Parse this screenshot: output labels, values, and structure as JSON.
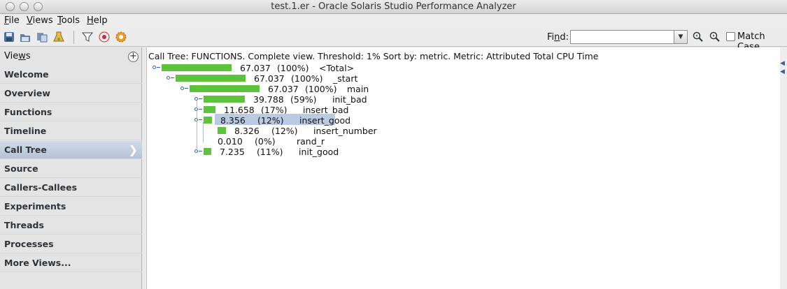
{
  "window": {
    "title": "test.1.er  -  Oracle Solaris Studio Performance Analyzer"
  },
  "menu": [
    {
      "pre": "",
      "key": "F",
      "post": "ile"
    },
    {
      "pre": "",
      "key": "V",
      "post": "iews"
    },
    {
      "pre": "",
      "key": "T",
      "post": "ools"
    },
    {
      "pre": "",
      "key": "H",
      "post": "elp"
    }
  ],
  "toolbar": {
    "find_pre": "Fi",
    "find_key": "n",
    "find_post": "d:",
    "find_value": "",
    "match_case_label": "Match Case",
    "match_case_checked": false
  },
  "sidebar": {
    "header_pre": "Vie",
    "header_key": "w",
    "header_post": "s",
    "add_symbol": "+",
    "items": [
      {
        "label": "Welcome",
        "active": false
      },
      {
        "label": "Overview",
        "active": false
      },
      {
        "label": "Functions",
        "active": false
      },
      {
        "label": "Timeline",
        "active": false
      },
      {
        "label": "Call Tree",
        "active": true
      },
      {
        "label": "Source",
        "active": false
      },
      {
        "label": "Callers-Callees",
        "active": false
      },
      {
        "label": "Experiments",
        "active": false
      },
      {
        "label": "Threads",
        "active": false
      },
      {
        "label": "Processes",
        "active": false
      },
      {
        "label": "More Views...",
        "active": false
      }
    ]
  },
  "calltree": {
    "header": "Call Tree: FUNCTIONS.   Complete view.   Threshold: 1%   Sort by: metric.   Metric: Attributed Total CPU Time",
    "rows": [
      {
        "value": "67.037",
        "percent": "(100%)",
        "name": "<Total>",
        "fraction": 1.0,
        "highlight": false
      },
      {
        "value": "67.037",
        "percent": "(100%)",
        "name": "_start",
        "fraction": 1.0,
        "highlight": false
      },
      {
        "value": "67.037",
        "percent": "(100%)",
        "name": "main",
        "fraction": 1.0,
        "highlight": false
      },
      {
        "value": "39.788",
        "percent": "(59%)",
        "name": "init_bad",
        "fraction": 0.59,
        "highlight": false
      },
      {
        "value": "11.658",
        "percent": "(17%)",
        "name": "insert_bad",
        "fraction": 0.17,
        "highlight": false
      },
      {
        "value": "8.356",
        "percent": "(12%)",
        "name": "insert_good",
        "fraction": 0.12,
        "highlight": true
      },
      {
        "value": "8.326",
        "percent": "(12%)",
        "name": "insert_number",
        "fraction": 0.12,
        "highlight": false
      },
      {
        "value": "0.010",
        "percent": "(0%)",
        "name": "rand_r",
        "fraction": 0.0,
        "highlight": false
      },
      {
        "value": "7.235",
        "percent": "(11%)",
        "name": "init_good",
        "fraction": 0.11,
        "highlight": false
      }
    ]
  }
}
